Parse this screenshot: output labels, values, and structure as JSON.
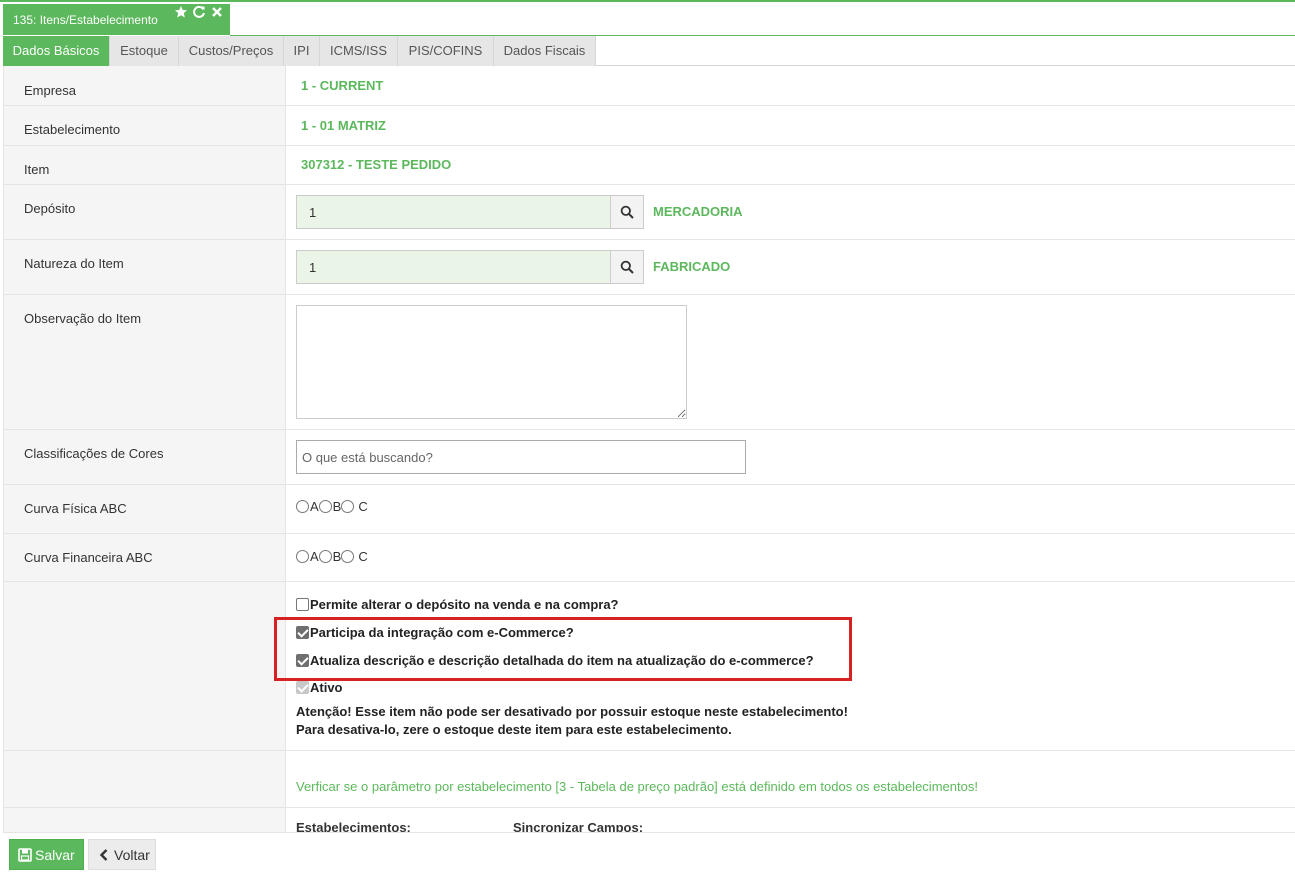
{
  "window": {
    "title": "135: Itens/Estabelecimento",
    "icons": [
      "star-icon",
      "refresh-icon",
      "close-icon"
    ]
  },
  "tabs": [
    {
      "label": "Dados Básicos",
      "active": true
    },
    {
      "label": "Estoque"
    },
    {
      "label": "Custos/Preços"
    },
    {
      "label": "IPI"
    },
    {
      "label": "ICMS/ISS"
    },
    {
      "label": "PIS/COFINS"
    },
    {
      "label": "Dados Fiscais"
    }
  ],
  "form": {
    "empresa": {
      "label": "Empresa",
      "value": "1 - CURRENT"
    },
    "estabelecimento": {
      "label": "Estabelecimento",
      "value": "1 - 01 MATRIZ"
    },
    "item": {
      "label": "Item",
      "value": "307312 - TESTE PEDIDO"
    },
    "deposito": {
      "label": "Depósito",
      "input_value": "1",
      "description": "MERCADORIA"
    },
    "natureza": {
      "label": "Natureza do Item",
      "input_value": "1",
      "description": "FABRICADO"
    },
    "observacao": {
      "label": "Observação do Item",
      "value": ""
    },
    "cores": {
      "label": "Classificações de Cores",
      "placeholder": "O que está buscando?"
    },
    "curva_fisica": {
      "label": "Curva Física ABC",
      "options": [
        "A",
        "B",
        "C"
      ]
    },
    "curva_financeira": {
      "label": "Curva Financeira ABC",
      "options": [
        "A",
        "B",
        "C"
      ]
    },
    "checkboxes": {
      "permite_alterar": {
        "label": "Permite alterar o depósito na venda e na compra?",
        "checked": false
      },
      "participa_ecommerce": {
        "label": "Participa da integração com e-Commerce?",
        "checked": true
      },
      "atualiza_descricao": {
        "label": "Atualiza descrição e descrição detalhada do item na atualização do e-commerce?",
        "checked": true
      },
      "ativo": {
        "label": "Ativo",
        "checked": true,
        "disabled": true
      }
    },
    "warning_line1": "Atenção! Esse item não pode ser desativado por possuir estoque neste estabelecimento!",
    "warning_line2": "Para desativa-lo, zere o estoque deste item para este estabelecimento.",
    "parametro_note": "Verficar se o parâmetro por estabelecimento [3 - Tabela de preço padrão] está definido em todos os estabelecimentos!",
    "estabelecimentos_label": "Estabelecimentos:",
    "sincronizar_label": "Sincronizar Campos:"
  },
  "footer": {
    "save_label": "Salvar",
    "back_label": "Voltar"
  },
  "colors": {
    "accent": "#5cb85c",
    "highlight": "#d62222"
  }
}
